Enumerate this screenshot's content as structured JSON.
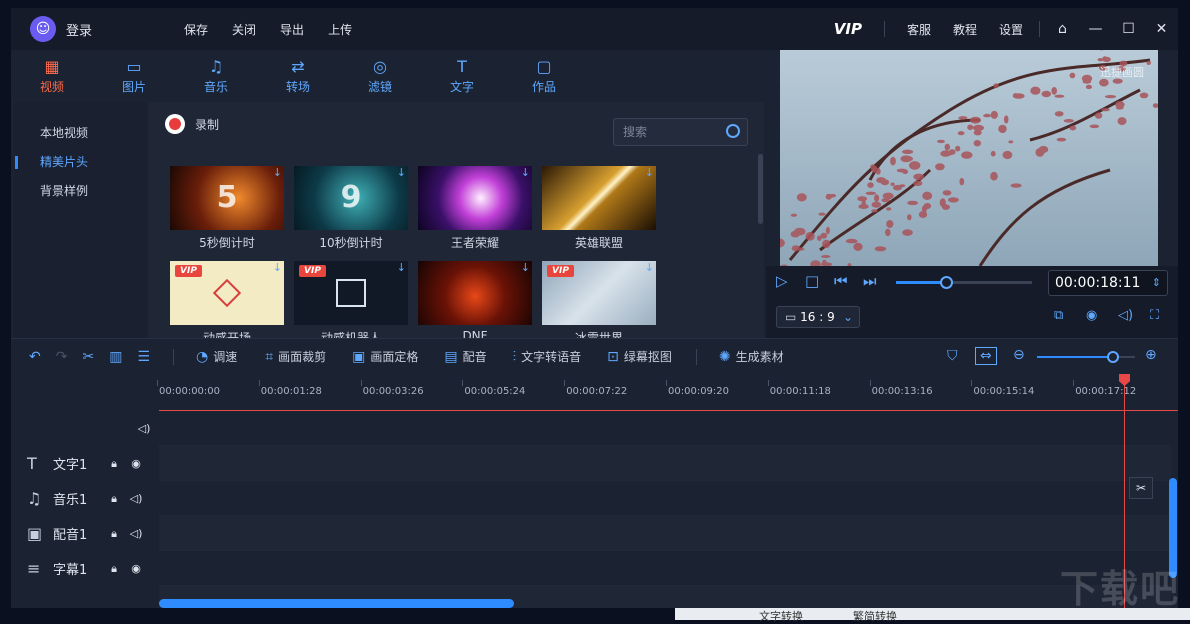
{
  "titlebar": {
    "login": "登录",
    "menu": [
      "保存",
      "关闭",
      "导出",
      "上传"
    ],
    "vip": "VIP",
    "links": [
      "客服",
      "教程",
      "设置"
    ]
  },
  "tabs": [
    {
      "label": "视频",
      "icon": "film-icon",
      "active": true
    },
    {
      "label": "图片",
      "icon": "image-icon"
    },
    {
      "label": "音乐",
      "icon": "music-icon"
    },
    {
      "label": "转场",
      "icon": "transition-icon"
    },
    {
      "label": "滤镜",
      "icon": "filter-icon"
    },
    {
      "label": "文字",
      "icon": "text-icon"
    },
    {
      "label": "作品",
      "icon": "folder-icon"
    }
  ],
  "library": {
    "categories": [
      "本地视频",
      "精美片头",
      "背景样例"
    ],
    "active_category": 1,
    "record_label": "录制",
    "search_placeholder": "搜索",
    "items": [
      {
        "label": "5秒倒计时",
        "vip": false,
        "glyph": "5"
      },
      {
        "label": "10秒倒计时",
        "vip": false,
        "glyph": "9"
      },
      {
        "label": "王者荣耀",
        "vip": false,
        "glyph": ""
      },
      {
        "label": "英雄联盟",
        "vip": false,
        "glyph": ""
      },
      {
        "label": "动感开场",
        "vip": true,
        "glyph": ""
      },
      {
        "label": "动感机器人",
        "vip": true,
        "glyph": ""
      },
      {
        "label": "DNF",
        "vip": false,
        "glyph": ""
      },
      {
        "label": "冰雪世界",
        "vip": true,
        "glyph": ""
      }
    ],
    "vip_badge": "VIP"
  },
  "preview": {
    "watermark": "迅捷画圆",
    "timecode": "00:00:18:11",
    "ratio": "16 : 9",
    "progress": 0.37
  },
  "toolbar": {
    "items": [
      "调速",
      "画面裁剪",
      "画面定格",
      "配音",
      "文字转语音",
      "绿幕抠图",
      "生成素材"
    ]
  },
  "timeline": {
    "ticks": [
      "00:00:00:00",
      "00:00:01:28",
      "00:00:03:26",
      "00:00:05:24",
      "00:00:07:22",
      "00:00:09:20",
      "00:00:11:18",
      "00:00:13:16",
      "00:00:15:14",
      "00:00:17:12"
    ],
    "zoom": 0.78,
    "tracks": [
      {
        "name": "文字1",
        "icon": "text-track-icon"
      },
      {
        "name": "音乐1",
        "icon": "music-track-icon"
      },
      {
        "name": "配音1",
        "icon": "voice-track-icon"
      },
      {
        "name": "字幕1",
        "icon": "subtitle-track-icon"
      }
    ]
  },
  "desktop": {
    "taskbar": [
      "文字转换",
      "繁简转换"
    ],
    "brand": "下载吧"
  },
  "colors": {
    "accent": "#2f8cff",
    "active_tab": "#ff6a4a",
    "playhead": "#e84848"
  }
}
